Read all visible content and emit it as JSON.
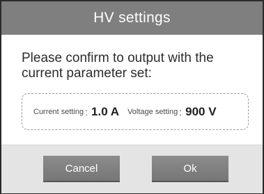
{
  "dialog": {
    "title": "HV settings",
    "message": "Please confirm to output with the current parameter set:",
    "current_label": "Current setting",
    "current_value": "1.0 A",
    "voltage_label": "Voltage setting",
    "voltage_value": "900 V",
    "separator": ":",
    "cancel_label": "Cancel",
    "ok_label": "Ok"
  },
  "colors": {
    "title_bar": "#7f7f7f",
    "button": "#808080",
    "footer": "#e4e4e4"
  }
}
